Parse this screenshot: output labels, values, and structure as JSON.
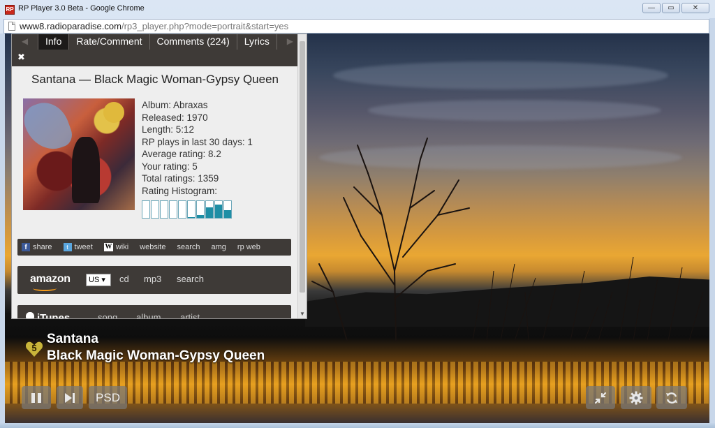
{
  "window": {
    "title": "RP Player 3.0 Beta - Google Chrome",
    "controls": {
      "minimize": "—",
      "maximize": "▭",
      "close": "✕"
    },
    "url_host": "www8.radioparadise.com",
    "url_path": "/rp3_player.php?mode=portrait&start=yes"
  },
  "panel": {
    "tabs": [
      {
        "label": "Info",
        "active": true
      },
      {
        "label": "Rate/Comment"
      },
      {
        "label": "Comments (224)"
      },
      {
        "label": "Lyrics"
      }
    ],
    "nav_prev": "◀",
    "nav_next": "▶",
    "close": "✖",
    "song_heading": "Santana — Black Magic Woman-Gypsy Queen",
    "meta": {
      "album": "Album: Abraxas",
      "released": "Released: 1970",
      "length": "Length: 5:12",
      "plays": "RP plays in last 30 days: 1",
      "avg": "Average rating: 8.2",
      "your": "Your rating: 5",
      "total": "Total ratings: 1359",
      "histogram_label": "Rating Histogram:"
    },
    "histogram": [
      0,
      0,
      0,
      0,
      0,
      0.05,
      0.18,
      0.62,
      0.78,
      0.45
    ],
    "share": [
      {
        "icon": "facebook-icon",
        "label": "share"
      },
      {
        "icon": "twitter-icon",
        "label": "tweet"
      },
      {
        "icon": "wikipedia-icon",
        "label": "wiki"
      },
      {
        "label": "website"
      },
      {
        "label": "search"
      },
      {
        "label": "amg"
      },
      {
        "label": "rp web"
      }
    ],
    "amazon": {
      "logo": "amazon",
      "store": "US ▾",
      "links": [
        "cd",
        "mp3",
        "search"
      ]
    },
    "itunes": {
      "logo": "iTunes",
      "links": [
        "song",
        "album",
        "artist"
      ]
    }
  },
  "now_playing": {
    "rating": "5",
    "artist": "Santana",
    "song": "Black Magic Woman-Gypsy Queen"
  },
  "controls": {
    "psd": "PSD"
  },
  "colors": {
    "panel_dark": "#3e3a37",
    "histogram_fill": "#1e8ea5",
    "heart": "#c9b53a"
  }
}
